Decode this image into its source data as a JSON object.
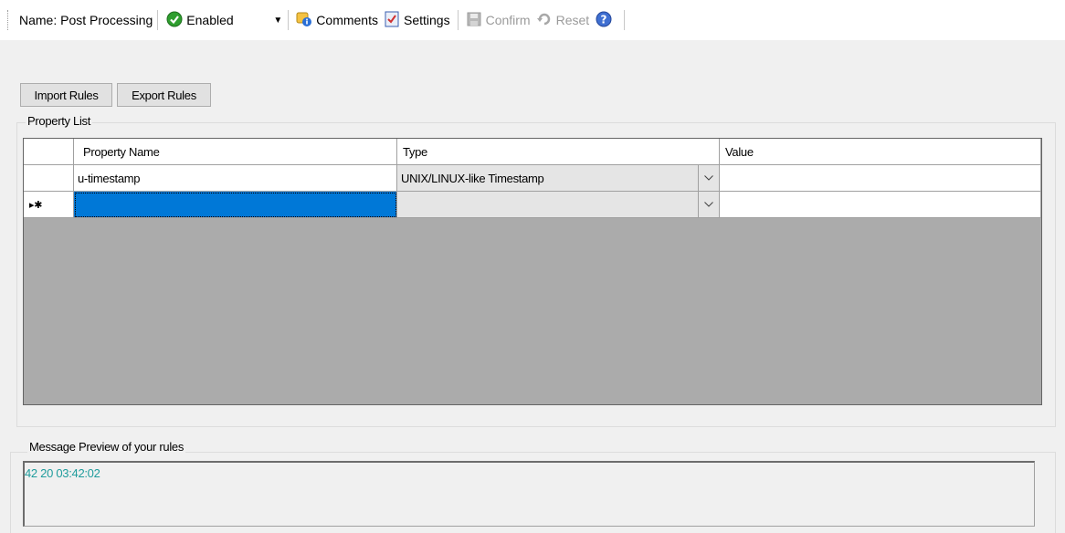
{
  "toolbar": {
    "name_label": "Name: Post Processing",
    "status_value": "Enabled",
    "comments_label": "Comments",
    "settings_label": "Settings",
    "confirm_label": "Confirm",
    "reset_label": "Reset"
  },
  "buttons": {
    "import_label": "Import Rules",
    "export_label": "Export Rules"
  },
  "property_list": {
    "title": "Property List",
    "columns": [
      "Property Name",
      "Type",
      "Value"
    ],
    "rows": [
      {
        "header": "",
        "name": "u-timestamp",
        "type": "UNIX/LINUX-like Timestamp",
        "value": ""
      }
    ],
    "new_row": {
      "header": "▸✱",
      "name": "",
      "type": "",
      "value": ""
    }
  },
  "preview": {
    "title": "Message Preview of your rules",
    "text": "42 20 03:42:02"
  },
  "colors": {
    "selection": "#0078d7",
    "preview_text": "#1f9c9c",
    "grid_background": "#ababab",
    "enabled_icon": "#2e9e2e"
  }
}
